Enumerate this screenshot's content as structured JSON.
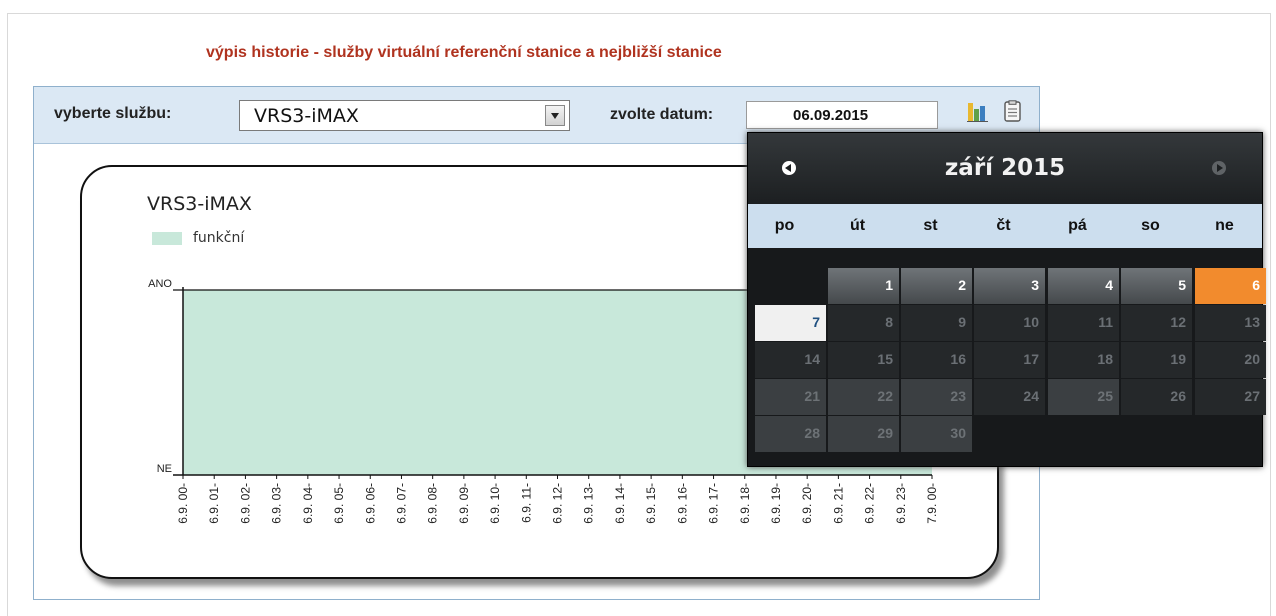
{
  "page_title": "výpis historie - služby virtuální referenční stanice a nejbližší stanice",
  "toolbar": {
    "service_label": "vyberte službu:",
    "service_value": "VRS3-iMAX",
    "date_label": "zvolte datum:",
    "date_value": "06.09.2015",
    "icons": [
      "bar-chart-icon",
      "document-icon"
    ]
  },
  "chart": {
    "series_title": "VRS3-iMAX",
    "legend_label": "funkční",
    "y_top_label": "ANO",
    "y_bottom_label": "NE"
  },
  "chart_data": {
    "type": "area",
    "title": "VRS3-iMAX",
    "categories": [
      "6.9. 00-",
      "6.9. 01-",
      "6.9. 02-",
      "6.9. 03-",
      "6.9. 04-",
      "6.9. 05-",
      "6.9. 06-",
      "6.9. 07-",
      "6.9. 08-",
      "6.9. 09-",
      "6.9. 10-",
      "6.9. 11-",
      "6.9. 12-",
      "6.9. 13-",
      "6.9. 14-",
      "6.9. 15-",
      "6.9. 16-",
      "6.9. 17-",
      "6.9. 18-",
      "6.9. 19-",
      "6.9. 20-",
      "6.9. 21-",
      "6.9. 22-",
      "6.9. 23-",
      "7.9. 00-"
    ],
    "series": [
      {
        "name": "funkční",
        "values": [
          1,
          1,
          1,
          1,
          1,
          1,
          1,
          1,
          1,
          1,
          1,
          1,
          1,
          1,
          1,
          1,
          1,
          1,
          1,
          1,
          1,
          1,
          1,
          1,
          1
        ],
        "color": "#c8e8da"
      }
    ],
    "y_categories": [
      "NE",
      "ANO"
    ],
    "ylim": [
      0,
      1
    ]
  },
  "calendar": {
    "title": "září 2015",
    "weekdays": [
      "po",
      "út",
      "st",
      "čt",
      "pá",
      "so",
      "ne"
    ],
    "weeks": [
      [
        {
          "d": "",
          "s": "empty"
        },
        {
          "d": "1",
          "s": "cur"
        },
        {
          "d": "2",
          "s": "cur"
        },
        {
          "d": "3",
          "s": "cur"
        },
        {
          "d": "4",
          "s": "cur"
        },
        {
          "d": "5",
          "s": "cur"
        },
        {
          "d": "6",
          "s": "sel"
        }
      ],
      [
        {
          "d": "7",
          "s": "today"
        },
        {
          "d": "8",
          "s": "other"
        },
        {
          "d": "9",
          "s": "other"
        },
        {
          "d": "10",
          "s": "other"
        },
        {
          "d": "11",
          "s": "other"
        },
        {
          "d": "12",
          "s": "other"
        },
        {
          "d": "13",
          "s": "other"
        }
      ],
      [
        {
          "d": "14",
          "s": "other"
        },
        {
          "d": "15",
          "s": "other"
        },
        {
          "d": "16",
          "s": "other"
        },
        {
          "d": "17",
          "s": "other"
        },
        {
          "d": "18",
          "s": "other"
        },
        {
          "d": "19",
          "s": "other"
        },
        {
          "d": "20",
          "s": "other"
        }
      ],
      [
        {
          "d": "21",
          "s": "dim"
        },
        {
          "d": "22",
          "s": "dim"
        },
        {
          "d": "23",
          "s": "dim"
        },
        {
          "d": "24",
          "s": "other"
        },
        {
          "d": "25",
          "s": "dim"
        },
        {
          "d": "26",
          "s": "other"
        },
        {
          "d": "27",
          "s": "other"
        }
      ],
      [
        {
          "d": "28",
          "s": "dim"
        },
        {
          "d": "29",
          "s": "dim"
        },
        {
          "d": "30",
          "s": "dim"
        }
      ]
    ],
    "selected_color": "#f28b2d"
  }
}
